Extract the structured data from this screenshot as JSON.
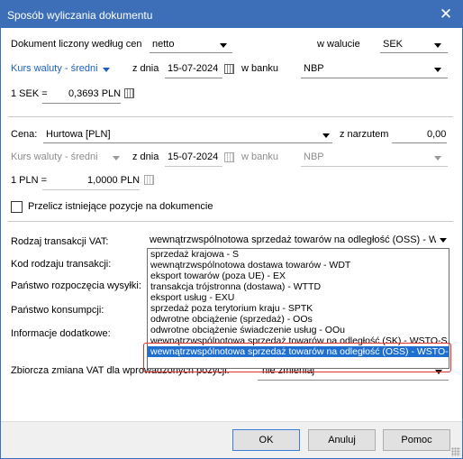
{
  "window": {
    "title": "Sposób wyliczania dokumentu",
    "close_glyph": "✕"
  },
  "row1": {
    "label": "Dokument liczony według cen",
    "price_type": "netto",
    "currency_label": "w walucie",
    "currency": "SEK"
  },
  "row2": {
    "rate_type": "Kurs waluty - średni",
    "date_label": "z dnia",
    "date": "15-07-2024",
    "bank_label": "w banku",
    "bank": "NBP"
  },
  "row3": {
    "lhs": "1 SEK =",
    "value": "0,3693 PLN"
  },
  "price": {
    "label": "Cena:",
    "value": "Hurtowa [PLN]",
    "markup_label": "z narzutem",
    "markup": "0,00"
  },
  "row5": {
    "rate_type": "Kurs waluty - średni",
    "date_label": "z dnia",
    "date": "15-07-2024",
    "bank_label": "w banku",
    "bank": "NBP"
  },
  "row6": {
    "lhs": "1 PLN =",
    "value": "1,0000 PLN"
  },
  "recalc": {
    "label": "Przelicz istniejące pozycje na dokumencie",
    "checked": false
  },
  "labels": {
    "vat_type": "Rodzaj transakcji VAT:",
    "code": "Kod rodzaju transakcji:",
    "start_country": "Państwo rozpoczęcia wysyłki:",
    "consumption_country": "Państwo konsumpcji:",
    "additional_info": "Informacje dodatkowe:",
    "vat_change": "Zbiorcza zmiana VAT dla wprowadzonych pozycji:"
  },
  "vat_type_value": "wewnątrzwspólnotowa sprzedaż towarów na odległość (OSS) - W",
  "vat_change_value": "nie zmieniaj",
  "dropdown_items": [
    "sprzedaż krajowa - S",
    "wewnątrzwspólnotowa dostawa towarów - WDT",
    "eksport towarów (poza UE) - EX",
    "transakcja trójstronna (dostawa) - WTTD",
    "eksport usług - EXU",
    "sprzedaż poza terytorium kraju - SPTK",
    "odwrotne obciążenie (sprzedaż) - OOs",
    "odwrotne obciążenie świadczenie usług - OOu",
    "wewnątrzwspólnotowa sprzedaż towarów na odległość (SK) - WSTO-S",
    "wewnątrzwspólnotowa sprzedaż towarów na odległość (OSS) - WSTO-OSS"
  ],
  "selected_index": 9,
  "buttons": {
    "ok": "OK",
    "cancel": "Anuluj",
    "help": "Pomoc"
  },
  "colors": {
    "title_bar": "#3d6fb8",
    "accent_blue": "#1e5fbf",
    "selection": "#1f6fd1",
    "highlight_border": "#e0302f"
  },
  "icons": {
    "calendar": "calendar-icon",
    "dropdown": "chevron-down-icon",
    "close": "close-icon"
  }
}
